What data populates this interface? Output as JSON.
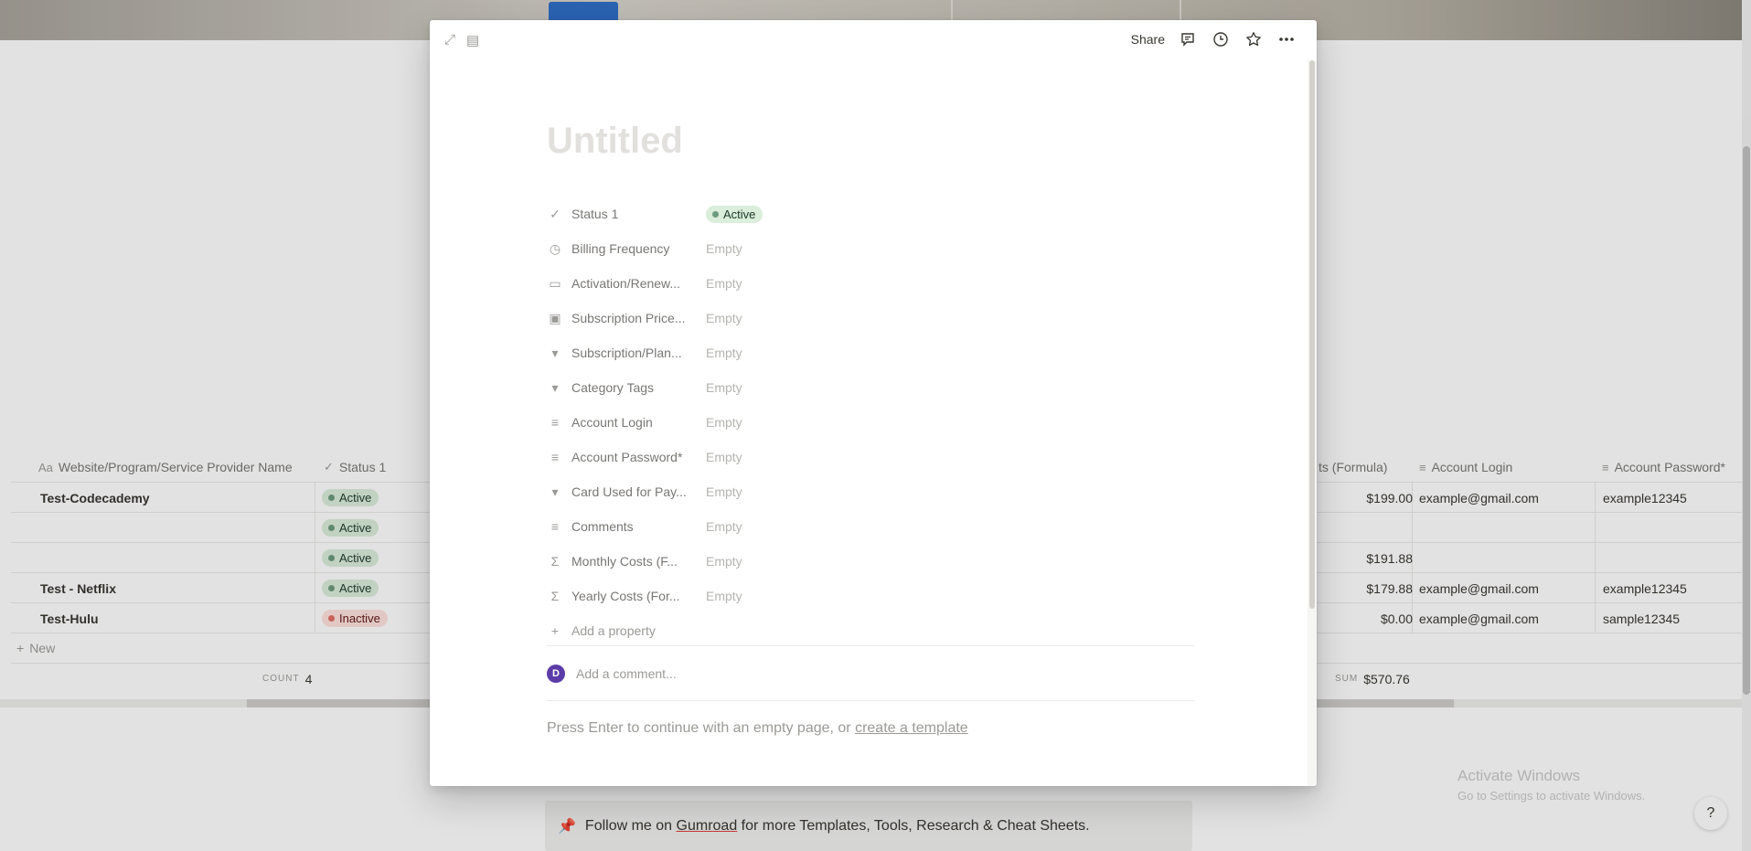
{
  "background": {
    "table": {
      "headers": [
        {
          "icon": "Aa",
          "label": "Website/Program/Service Provider Name"
        },
        {
          "icon": "✓",
          "label": "Status 1"
        },
        {
          "icon": "",
          "label": "ts (Formula)"
        },
        {
          "icon": "≡",
          "label": "Account Login"
        },
        {
          "icon": "≡",
          "label": "Account Password*"
        }
      ],
      "rows": [
        {
          "name": "Test-Codecademy",
          "status": "Active",
          "yearly": "$199.00",
          "login": "example@gmail.com",
          "password": "example12345"
        },
        {
          "name": "",
          "status": "Active",
          "yearly": "",
          "login": "",
          "password": ""
        },
        {
          "name": "",
          "status": "Active",
          "yearly": "$191.88",
          "login": "",
          "password": ""
        },
        {
          "name": "Test - Netflix",
          "status": "Active",
          "yearly": "$179.88",
          "login": "example@gmail.com",
          "password": "example12345"
        },
        {
          "name": "Test-Hulu",
          "status": "Inactive",
          "yearly": "$0.00",
          "login": "example@gmail.com",
          "password": "sample12345"
        }
      ],
      "new_label": "New",
      "count_label": "COUNT",
      "count_value": "4",
      "sum_label": "SUM",
      "sum_value": "$570.76"
    },
    "callout": {
      "icon": "📌",
      "before": "Follow me on ",
      "link": "Gumroad",
      "after": " for more Templates, Tools, Research & Cheat Sheets."
    },
    "watermark": {
      "line1": "Activate Windows",
      "line2": "Go to Settings to activate Windows."
    },
    "help_label": "?"
  },
  "modal": {
    "share_label": "Share",
    "title_placeholder": "Untitled",
    "properties": [
      {
        "icon": "✓",
        "name": "Status 1",
        "value": "Active",
        "kind": "status"
      },
      {
        "icon": "◷",
        "name": "Billing Frequency",
        "value": "Empty"
      },
      {
        "icon": "▭",
        "name": "Activation/Renew...",
        "value": "Empty"
      },
      {
        "icon": "▣",
        "name": "Subscription Price...",
        "value": "Empty"
      },
      {
        "icon": "▾",
        "name": "Subscription/Plan...",
        "value": "Empty"
      },
      {
        "icon": "▾",
        "name": "Category Tags",
        "value": "Empty"
      },
      {
        "icon": "≡",
        "name": "Account Login",
        "value": "Empty"
      },
      {
        "icon": "≡",
        "name": "Account Password*",
        "value": "Empty"
      },
      {
        "icon": "▾",
        "name": "Card Used for Pay...",
        "value": "Empty"
      },
      {
        "icon": "≡",
        "name": "Comments",
        "value": "Empty"
      },
      {
        "icon": "Σ",
        "name": "Monthly Costs (F...",
        "value": "Empty"
      },
      {
        "icon": "Σ",
        "name": "Yearly Costs (For...",
        "value": "Empty"
      }
    ],
    "add_property_label": "Add a property",
    "avatar_initial": "D",
    "comment_placeholder": "Add a comment...",
    "hint_text": "Press Enter to continue with an empty page, or ",
    "hint_link": "create a template"
  },
  "colors": {
    "active_bg": "#dbeddb",
    "inactive_bg": "#ffe2dd",
    "avatar": "#5b3ca8"
  }
}
